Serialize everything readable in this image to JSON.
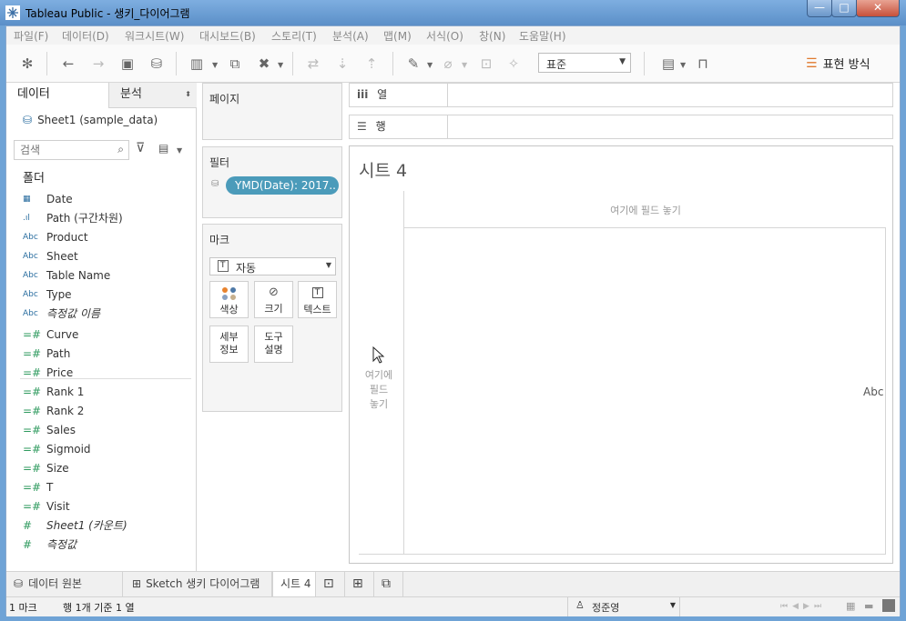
{
  "window": {
    "title": "Tableau Public - 생키_다이어그램",
    "buttons": {
      "minimize": "—",
      "maximize": "□",
      "close": "✕"
    }
  },
  "menu": [
    "파일(F)",
    "데이터(D)",
    "워크시트(W)",
    "대시보드(B)",
    "스토리(T)",
    "분석(A)",
    "맵(M)",
    "서식(O)",
    "창(N)",
    "도움말(H)"
  ],
  "toolbar": {
    "fit_value": "표준",
    "show_me_label": "표현 방식"
  },
  "left_pane": {
    "tab_data": "데이터",
    "tab_analysis": "분석",
    "datasource": "Sheet1 (sample_data)",
    "search_placeholder": "검색",
    "folder_label": "폴더",
    "dimensions": [
      {
        "icon": "calendar-icon",
        "glyph": "▦",
        "name": "Date"
      },
      {
        "icon": "bin-icon",
        "glyph": ".ıl",
        "name": "Path (구간차원)"
      },
      {
        "icon": "abc-icon",
        "glyph": "Abc",
        "name": "Product"
      },
      {
        "icon": "abc-icon",
        "glyph": "Abc",
        "name": "Sheet"
      },
      {
        "icon": "abc-icon",
        "glyph": "Abc",
        "name": "Table Name"
      },
      {
        "icon": "abc-icon",
        "glyph": "Abc",
        "name": "Type"
      },
      {
        "icon": "abc-icon",
        "glyph": "Abc",
        "name": "측정값 이름"
      }
    ],
    "measures": [
      {
        "name": "Curve"
      },
      {
        "name": "Path"
      },
      {
        "name": "Price"
      },
      {
        "name": "Rank 1"
      },
      {
        "name": "Rank 2"
      },
      {
        "name": "Sales"
      },
      {
        "name": "Sigmoid"
      },
      {
        "name": "Size"
      },
      {
        "name": "T"
      },
      {
        "name": "Visit"
      },
      {
        "name": "Sheet1 (카운트)"
      },
      {
        "name": "측정값"
      }
    ]
  },
  "pages_card": {
    "title": "페이지"
  },
  "filters_card": {
    "title": "필터",
    "pill": "YMD(Date): 2017.."
  },
  "marks_card": {
    "title": "마크",
    "type": "자동",
    "buttons": [
      {
        "id": "color",
        "label": "색상"
      },
      {
        "id": "size",
        "label": "크기"
      },
      {
        "id": "text",
        "label": "텍스트"
      },
      {
        "id": "detail",
        "label": "세부\n정보"
      },
      {
        "id": "tooltip",
        "label": "도구\n설명"
      }
    ]
  },
  "shelves": {
    "columns": "열",
    "rows": "행"
  },
  "view": {
    "sheet_title": "시트 4",
    "drop_columns": "여기에 필드 놓기",
    "drop_rows": "여기에\n필드\n놓기",
    "abc": "Abc"
  },
  "sheet_tabs": {
    "datasource": "데이터 원본",
    "sketch": "Sketch 생키 다이어그램",
    "sheet4": "시트 4"
  },
  "status": {
    "marks": "1 마크",
    "rows_cols": "행 1개 기준 1 열",
    "user": "정준영"
  },
  "colors": {
    "filter_pill": "#4b9bba",
    "measure_green": "#2e9a5e",
    "dimension_blue": "#2b6ea0",
    "titlebar": "#5b8fc8"
  }
}
